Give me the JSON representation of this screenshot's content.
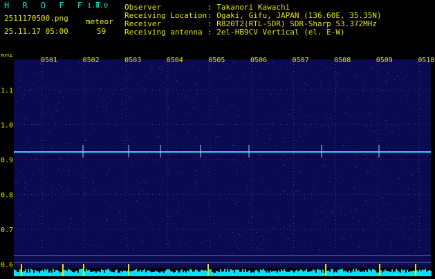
{
  "app": {
    "title": "H R O F F T",
    "version": "1.0.0"
  },
  "file": {
    "name": "2511170500.png",
    "datetime": "25.11.17 05:00"
  },
  "meteor": {
    "label": "meteor",
    "count": "59"
  },
  "info": [
    {
      "label": "Observer",
      "value": ": Takanori Kawachi"
    },
    {
      "label": "Receiving Location",
      "value": ": Ogaki, Gifu, JAPAN (136.60E, 35.35N)"
    },
    {
      "label": "Receiver",
      "value": ": R820T2(RTL-SDR) SDR-Sharp 53.372MHz"
    },
    {
      "label": "Receiving antenna",
      "value": ": 2el-HB9CV Vertical (el. E-W)"
    }
  ],
  "axes": {
    "y_unit": "kHz",
    "y_ticks": [
      "1.1",
      "1.0",
      "0.9",
      "0.8",
      "0.7",
      "0.6"
    ],
    "x_ticks": [
      "0501",
      "0502",
      "0503",
      "0504",
      "0505",
      "0506",
      "0507",
      "0508",
      "0509",
      "0510"
    ]
  },
  "colors": {
    "background": "#0a0a50",
    "carrier": "#40c8ff",
    "labels": "#e6e600",
    "power_bar": "#00e0ff"
  }
}
